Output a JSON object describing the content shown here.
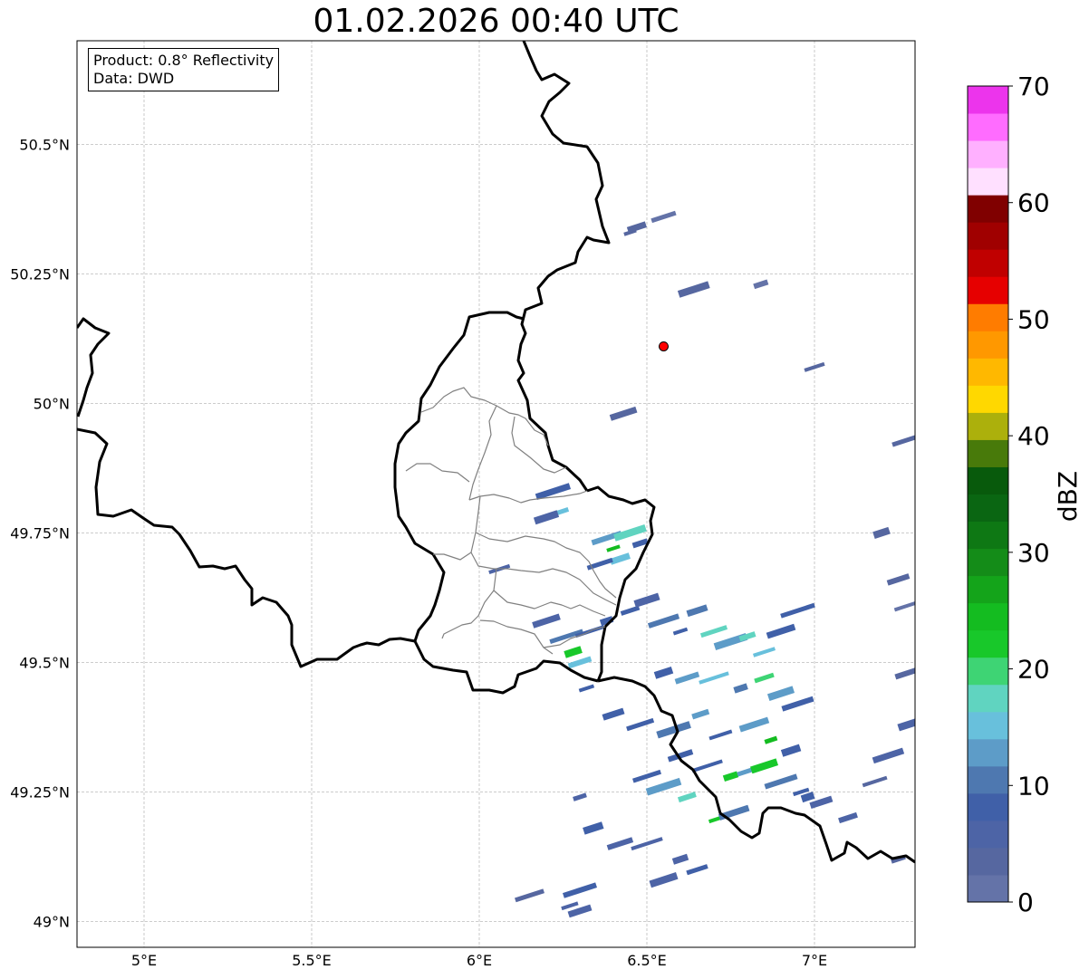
{
  "title": "01.02.2026 00:40 UTC",
  "info": {
    "product": "Product: 0.8° Reflectivity",
    "data": "Data: DWD"
  },
  "axes": {
    "x_ticks": [
      {
        "value": 5.0,
        "label": "5°E"
      },
      {
        "value": 5.5,
        "label": "5.5°E"
      },
      {
        "value": 6.0,
        "label": "6°E"
      },
      {
        "value": 6.5,
        "label": "6.5°E"
      },
      {
        "value": 7.0,
        "label": "7°E"
      }
    ],
    "y_ticks": [
      {
        "value": 49.0,
        "label": "49°N"
      },
      {
        "value": 49.25,
        "label": "49.25°N"
      },
      {
        "value": 49.5,
        "label": "49.5°N"
      },
      {
        "value": 49.75,
        "label": "49.75°N"
      },
      {
        "value": 50.0,
        "label": "50°N"
      },
      {
        "value": 50.25,
        "label": "50.25°N"
      },
      {
        "value": 50.5,
        "label": "50.5°N"
      }
    ],
    "lon_range": [
      4.8,
      7.3
    ],
    "lat_range": [
      48.95,
      50.7
    ],
    "grid": true
  },
  "radar_site": {
    "lon": 6.55,
    "lat": 50.11,
    "color": "#ff0000"
  },
  "colorbar": {
    "label": "dBZ",
    "range": [
      0,
      70
    ],
    "ticks": [
      {
        "value": 0,
        "label": "0"
      },
      {
        "value": 10,
        "label": "10"
      },
      {
        "value": 20,
        "label": "20"
      },
      {
        "value": 30,
        "label": "30"
      },
      {
        "value": 40,
        "label": "40"
      },
      {
        "value": 50,
        "label": "50"
      },
      {
        "value": 60,
        "label": "60"
      },
      {
        "value": 70,
        "label": "70"
      }
    ],
    "colors": [
      "#6473a8",
      "#5667a0",
      "#4d64a6",
      "#4060a8",
      "#4e78b0",
      "#5d9cc8",
      "#68c0dc",
      "#60d4c0",
      "#3ed474",
      "#18c82a",
      "#14bc20",
      "#14a41a",
      "#148c18",
      "#0e7814",
      "#0a6612",
      "#085a0c",
      "#487a0a",
      "#acb00c",
      "#ffd800",
      "#ffb800",
      "#ff9800",
      "#ff7c00",
      "#e60000",
      "#c00000",
      "#a00000",
      "#800000",
      "#ffe0ff",
      "#ffb0ff",
      "#ff6cff",
      "#ec34ec"
    ]
  },
  "echoes": [
    {
      "lon": 6.45,
      "lat": 50.33,
      "dbz": 3
    },
    {
      "lon": 6.47,
      "lat": 50.34,
      "dbz": 3
    },
    {
      "lon": 6.55,
      "lat": 50.36,
      "dbz": 2
    },
    {
      "lon": 6.64,
      "lat": 50.22,
      "dbz": 3
    },
    {
      "lon": 6.84,
      "lat": 50.23,
      "dbz": 2
    },
    {
      "lon": 7.0,
      "lat": 50.07,
      "dbz": 3
    },
    {
      "lon": 6.43,
      "lat": 49.98,
      "dbz": 3
    },
    {
      "lon": 7.28,
      "lat": 49.93,
      "dbz": 4
    },
    {
      "lon": 7.2,
      "lat": 49.75,
      "dbz": 3
    },
    {
      "lon": 7.25,
      "lat": 49.66,
      "dbz": 3
    },
    {
      "lon": 7.28,
      "lat": 49.61,
      "dbz": 2
    },
    {
      "lon": 6.22,
      "lat": 49.83,
      "dbz": 8
    },
    {
      "lon": 6.24,
      "lat": 49.79,
      "dbz": 14
    },
    {
      "lon": 6.2,
      "lat": 49.78,
      "dbz": 6
    },
    {
      "lon": 6.38,
      "lat": 49.74,
      "dbz": 12
    },
    {
      "lon": 6.4,
      "lat": 49.72,
      "dbz": 24
    },
    {
      "lon": 6.42,
      "lat": 49.7,
      "dbz": 16
    },
    {
      "lon": 6.36,
      "lat": 49.69,
      "dbz": 9
    },
    {
      "lon": 6.45,
      "lat": 49.75,
      "dbz": 18
    },
    {
      "lon": 6.48,
      "lat": 49.73,
      "dbz": 7
    },
    {
      "lon": 6.06,
      "lat": 49.68,
      "dbz": 5
    },
    {
      "lon": 6.2,
      "lat": 49.58,
      "dbz": 5
    },
    {
      "lon": 6.26,
      "lat": 49.55,
      "dbz": 10
    },
    {
      "lon": 6.28,
      "lat": 49.52,
      "dbz": 22
    },
    {
      "lon": 6.3,
      "lat": 49.5,
      "dbz": 14
    },
    {
      "lon": 6.33,
      "lat": 49.56,
      "dbz": 8
    },
    {
      "lon": 6.38,
      "lat": 49.58,
      "dbz": 7
    },
    {
      "lon": 6.45,
      "lat": 49.6,
      "dbz": 9
    },
    {
      "lon": 6.5,
      "lat": 49.62,
      "dbz": 6
    },
    {
      "lon": 6.55,
      "lat": 49.58,
      "dbz": 11
    },
    {
      "lon": 6.6,
      "lat": 49.56,
      "dbz": 8
    },
    {
      "lon": 6.65,
      "lat": 49.6,
      "dbz": 10
    },
    {
      "lon": 6.7,
      "lat": 49.56,
      "dbz": 17
    },
    {
      "lon": 6.75,
      "lat": 49.54,
      "dbz": 12
    },
    {
      "lon": 6.8,
      "lat": 49.55,
      "dbz": 18
    },
    {
      "lon": 6.85,
      "lat": 49.52,
      "dbz": 14
    },
    {
      "lon": 6.9,
      "lat": 49.56,
      "dbz": 9
    },
    {
      "lon": 6.95,
      "lat": 49.6,
      "dbz": 7
    },
    {
      "lon": 6.55,
      "lat": 49.48,
      "dbz": 9
    },
    {
      "lon": 6.62,
      "lat": 49.47,
      "dbz": 12
    },
    {
      "lon": 6.7,
      "lat": 49.47,
      "dbz": 16
    },
    {
      "lon": 6.78,
      "lat": 49.45,
      "dbz": 11
    },
    {
      "lon": 6.85,
      "lat": 49.47,
      "dbz": 20
    },
    {
      "lon": 6.9,
      "lat": 49.44,
      "dbz": 12
    },
    {
      "lon": 6.95,
      "lat": 49.42,
      "dbz": 8
    },
    {
      "lon": 6.32,
      "lat": 49.45,
      "dbz": 7
    },
    {
      "lon": 6.4,
      "lat": 49.4,
      "dbz": 9
    },
    {
      "lon": 6.48,
      "lat": 49.38,
      "dbz": 8
    },
    {
      "lon": 6.58,
      "lat": 49.37,
      "dbz": 10
    },
    {
      "lon": 6.66,
      "lat": 49.4,
      "dbz": 13
    },
    {
      "lon": 6.72,
      "lat": 49.36,
      "dbz": 9
    },
    {
      "lon": 6.82,
      "lat": 49.38,
      "dbz": 12
    },
    {
      "lon": 6.87,
      "lat": 49.35,
      "dbz": 24
    },
    {
      "lon": 6.93,
      "lat": 49.33,
      "dbz": 9
    },
    {
      "lon": 6.6,
      "lat": 49.32,
      "dbz": 7
    },
    {
      "lon": 6.68,
      "lat": 49.3,
      "dbz": 9
    },
    {
      "lon": 6.75,
      "lat": 49.28,
      "dbz": 21
    },
    {
      "lon": 6.8,
      "lat": 49.29,
      "dbz": 13
    },
    {
      "lon": 6.85,
      "lat": 49.3,
      "dbz": 22
    },
    {
      "lon": 6.9,
      "lat": 49.27,
      "dbz": 10
    },
    {
      "lon": 6.96,
      "lat": 49.25,
      "dbz": 9
    },
    {
      "lon": 7.02,
      "lat": 49.23,
      "dbz": 6
    },
    {
      "lon": 6.5,
      "lat": 49.28,
      "dbz": 9
    },
    {
      "lon": 6.55,
      "lat": 49.26,
      "dbz": 12
    },
    {
      "lon": 6.62,
      "lat": 49.24,
      "dbz": 18
    },
    {
      "lon": 6.72,
      "lat": 49.2,
      "dbz": 22
    },
    {
      "lon": 6.76,
      "lat": 49.21,
      "dbz": 10
    },
    {
      "lon": 6.3,
      "lat": 49.24,
      "dbz": 6
    },
    {
      "lon": 6.34,
      "lat": 49.18,
      "dbz": 9
    },
    {
      "lon": 6.42,
      "lat": 49.15,
      "dbz": 6
    },
    {
      "lon": 6.5,
      "lat": 49.15,
      "dbz": 6
    },
    {
      "lon": 6.6,
      "lat": 49.12,
      "dbz": 5
    },
    {
      "lon": 6.65,
      "lat": 49.1,
      "dbz": 7
    },
    {
      "lon": 6.55,
      "lat": 49.08,
      "dbz": 6
    },
    {
      "lon": 6.3,
      "lat": 49.06,
      "dbz": 8
    },
    {
      "lon": 6.27,
      "lat": 49.03,
      "dbz": 6
    },
    {
      "lon": 6.3,
      "lat": 49.02,
      "dbz": 5
    },
    {
      "lon": 6.15,
      "lat": 49.05,
      "dbz": 4
    },
    {
      "lon": 6.98,
      "lat": 49.24,
      "dbz": 8
    },
    {
      "lon": 7.1,
      "lat": 49.2,
      "dbz": 5
    },
    {
      "lon": 7.18,
      "lat": 49.27,
      "dbz": 4
    },
    {
      "lon": 7.22,
      "lat": 49.32,
      "dbz": 6
    },
    {
      "lon": 7.25,
      "lat": 49.12,
      "dbz": 4
    },
    {
      "lon": 7.28,
      "lat": 49.38,
      "dbz": 5
    },
    {
      "lon": 7.28,
      "lat": 49.48,
      "dbz": 3
    }
  ]
}
